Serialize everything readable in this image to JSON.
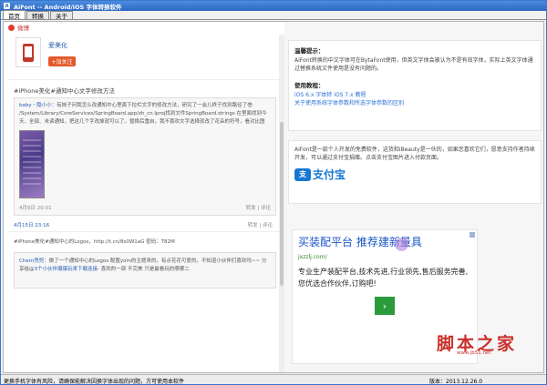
{
  "window": {
    "title": "AiFont -- Android/iOS 字体转换软件"
  },
  "tabs": [
    {
      "label": "首页"
    },
    {
      "label": "转换"
    },
    {
      "label": "关于"
    }
  ],
  "weibo": {
    "label": "微博"
  },
  "profile": {
    "name": "爱美化",
    "follow_label": "+加关注"
  },
  "post1": {
    "title": "#iPhone美化#通知中心文字修改方法",
    "user": "baby・隐小小",
    "text": "：有妹子问我怎么改通知中心里面下拉栏文字的修改方法，研究了一会儿终于找到路径了😎 /System/Library/CoreServices/SpringBoard.app/zh_cn.lproj找到文件SpringBoard.strings 在里面找到今天、全部、未读通知，把这几个字改掉就可以了。替换后重启，我不喜欢文字选择就改了花朵的符号，看对比图",
    "date": "4月8日 20:01",
    "forward": "转发",
    "comment": "评论"
  },
  "post1_outer": {
    "date": "4月15日 23:16",
    "forward": "转发",
    "comment": "评论"
  },
  "post2": {
    "title": "#iPhone美化#通知中心的Logos，http://t.cn/8s0W1aG 密码：T82M",
    "user": "Chem兜兜",
    "text": "：做了一个通知中心的Logos 配置yom的主题来的。有点花花可爱的。不知道小伙伴们喜欢吗~~ 分享给@",
    "link": "3个小伙伴爆爆玩来下载连接",
    "text2": "- 喜欢的一部 不完美 只是最看玩的哪哪二"
  },
  "help": {
    "heading1": "温馨提示：",
    "text1": "AiFont转换的中文字体可在BytaFont使用，但英文字体会被认为不是有效字体，实际上英文字体通过替换系统文件使用是没有问题的。",
    "heading2": "使用教程：",
    "link1": "iOS 6.x 字体转 iOS 7.x 教程",
    "link2": "关于使用系统字体参数和所选字体参数的区别"
  },
  "about": {
    "text": "AiFont是一款个人开发的免费软件，这货和iBeauty是一伙的，如果您喜欢它们，愿意支持作者持续开发，可以通过支付宝捐赠。点击支付宝图片进入付款页面。",
    "alipay_word": "支付宝",
    "alipay_mark": "支"
  },
  "ad": {
    "headline": "买装配平台 推荐建新量具",
    "url": "jxzzlj.com/",
    "body": "专业生产装配平台,技术先进,行业领先,售后服务完善,您优选合作伙伴,订购吧!",
    "arrow": "›"
  },
  "watermark": {
    "text": "脚本之家",
    "url": "www.jb51.net"
  },
  "status": {
    "message": "更换手机字体有风险，请确保能解决因换字体出现的问题，方可使用本软件",
    "version": "版本：2013.12.26.0"
  }
}
